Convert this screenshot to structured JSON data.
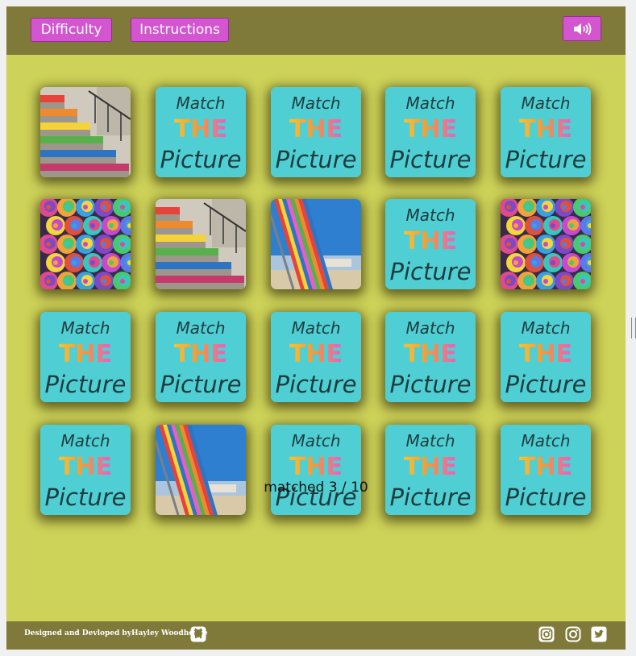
{
  "header": {
    "difficulty_label": "Difficulty",
    "instructions_label": "Instructions",
    "sound_icon": "volume-up-icon"
  },
  "card_back": {
    "line1": "Match",
    "line2": "THE",
    "line3": "Picture"
  },
  "board": {
    "columns": 5,
    "rows": 4,
    "cards": [
      "rainbow-stairs",
      "back",
      "back",
      "back",
      "back",
      "rainbow-roses",
      "rainbow-stairs",
      "striped-deckchair",
      "back",
      "rainbow-roses",
      "back",
      "back",
      "back",
      "back",
      "back",
      "back",
      "striped-deckchair",
      "back",
      "back",
      "back"
    ]
  },
  "status": {
    "text": "matched 3 / 10"
  },
  "footer": {
    "credit": "Designed and Devloped byHayley Woodhouse",
    "icons": [
      "github-icon",
      "instagram-icon",
      "instagram-icon",
      "twitter-icon"
    ]
  },
  "colors": {
    "background": "#cdd258",
    "header": "#7f7a3a",
    "button": "#d355cf",
    "card_back": "#4fcfd4"
  }
}
